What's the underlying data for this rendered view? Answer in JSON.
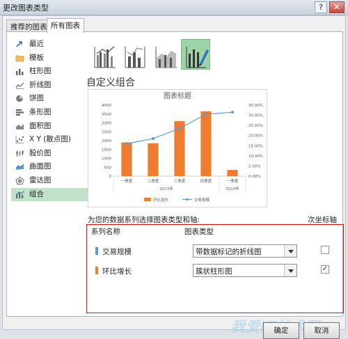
{
  "window": {
    "title": "更改图表类型",
    "help_label": "?",
    "close_label": "✕"
  },
  "tabs": [
    {
      "label": "推荐的图表"
    },
    {
      "label": "所有图表"
    }
  ],
  "left_types": [
    {
      "label": "最近",
      "icon": "recent-icon"
    },
    {
      "label": "模板",
      "icon": "folder-icon"
    },
    {
      "label": "柱形图",
      "icon": "column-chart-icon"
    },
    {
      "label": "折线图",
      "icon": "line-chart-icon"
    },
    {
      "label": "饼图",
      "icon": "pie-chart-icon"
    },
    {
      "label": "条形图",
      "icon": "bar-chart-icon"
    },
    {
      "label": "面积图",
      "icon": "area-chart-icon"
    },
    {
      "label": "X Y (散点图)",
      "icon": "scatter-chart-icon"
    },
    {
      "label": "股价图",
      "icon": "stock-chart-icon"
    },
    {
      "label": "曲面图",
      "icon": "surface-chart-icon"
    },
    {
      "label": "雷达图",
      "icon": "radar-chart-icon"
    },
    {
      "label": "组合",
      "icon": "combo-chart-icon"
    }
  ],
  "selected_type": "组合",
  "section_title": "自定义组合",
  "instruction": "为您的数据系列选择图表类型和轴:",
  "series_table": {
    "col_name": "系列名称",
    "col_type": "图表类型",
    "col_axis": "次坐标轴",
    "rows": [
      {
        "name": "交易规模",
        "color": "#5b9bd5",
        "chart_type": "带数据标记的折线图",
        "secondary": false
      },
      {
        "name": "环比增长",
        "color": "#ed7d31",
        "chart_type": "簇状柱形图",
        "secondary": true
      }
    ]
  },
  "buttons": {
    "ok": "确定",
    "cancel": "取消"
  },
  "watermark": "我爱IT技术网",
  "chart_data": {
    "type": "bar",
    "title": "图表标题",
    "categories": [
      "一季度",
      "二季度",
      "三季度",
      "四季度",
      "一季度"
    ],
    "group_labels": [
      {
        "label": "2013年"
      },
      {
        "label": "2014年"
      }
    ],
    "series": [
      {
        "name": "环比增长",
        "kind": "bar",
        "color": "#ed7d31",
        "axis": "left",
        "values": [
          1900,
          1850,
          3100,
          3650,
          350
        ]
      },
      {
        "name": "交易规模",
        "kind": "line",
        "color": "#5b9bd5",
        "axis": "right",
        "values": [
          0.16,
          0.185,
          0.235,
          0.305,
          0.315
        ]
      }
    ],
    "y_left": {
      "min": 0,
      "max": 4000,
      "ticks": [
        "0",
        "500",
        "1000",
        "1500",
        "2000",
        "2500",
        "3000",
        "3500",
        "4000"
      ]
    },
    "y_right": {
      "min": 0,
      "max": 0.35,
      "ticks": [
        "0.00%",
        "5.00%",
        "10.00%",
        "15.00%",
        "20.00%",
        "25.00%",
        "30.00%",
        "35.00%"
      ]
    },
    "legend": [
      "环比增长",
      "交易规模"
    ],
    "legend_position": "bottom"
  }
}
